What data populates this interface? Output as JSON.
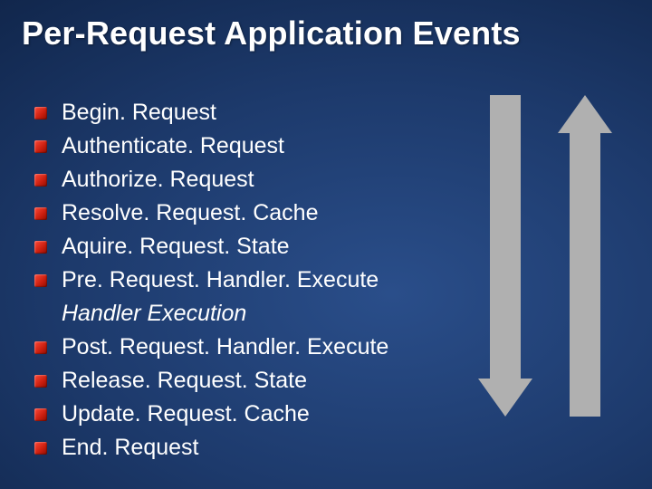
{
  "title": "Per-Request Application Events",
  "items": [
    {
      "label": "Begin. Request",
      "bullet": true,
      "italic": false
    },
    {
      "label": "Authenticate. Request",
      "bullet": true,
      "italic": false
    },
    {
      "label": "Authorize. Request",
      "bullet": true,
      "italic": false
    },
    {
      "label": "Resolve. Request. Cache",
      "bullet": true,
      "italic": false
    },
    {
      "label": "Aquire. Request. State",
      "bullet": true,
      "italic": false
    },
    {
      "label": "Pre. Request. Handler. Execute",
      "bullet": true,
      "italic": false
    },
    {
      "label": "Handler Execution",
      "bullet": false,
      "italic": true
    },
    {
      "label": "Post. Request. Handler. Execute",
      "bullet": true,
      "italic": false
    },
    {
      "label": "Release. Request. State",
      "bullet": true,
      "italic": false
    },
    {
      "label": "Update. Request. Cache",
      "bullet": true,
      "italic": false
    },
    {
      "label": "End. Request",
      "bullet": true,
      "italic": false
    }
  ]
}
